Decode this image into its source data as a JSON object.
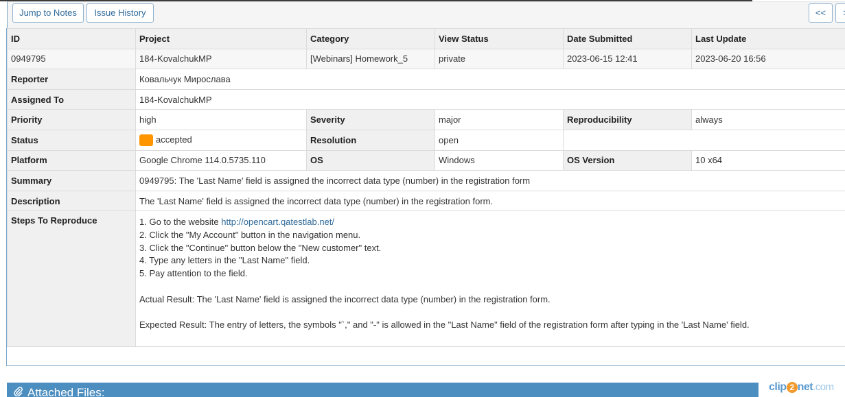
{
  "toolbar": {
    "jump_to_notes": "Jump to Notes",
    "issue_history": "Issue History",
    "prev": "<<",
    "next": ">"
  },
  "header": {
    "id": "ID",
    "project": "Project",
    "category": "Category",
    "view_status": "View Status",
    "date_submitted": "Date Submitted",
    "last_update": "Last Update"
  },
  "issue": {
    "id": "0949795",
    "project": "184-KovalchukMP",
    "category": "[Webinars] Homework_5",
    "view_status": "private",
    "date_submitted": "2023-06-15 12:41",
    "last_update": "2023-06-20 16:56"
  },
  "labels": {
    "reporter": "Reporter",
    "assigned_to": "Assigned To",
    "priority": "Priority",
    "severity": "Severity",
    "reproducibility": "Reproducibility",
    "status": "Status",
    "resolution": "Resolution",
    "platform": "Platform",
    "os": "OS",
    "os_version": "OS Version",
    "summary": "Summary",
    "description": "Description",
    "steps": "Steps To Reproduce"
  },
  "values": {
    "reporter": "Ковальчук Мирослава",
    "assigned_to": "184-KovalchukMP",
    "priority": "high",
    "severity": "major",
    "reproducibility": "always",
    "status": "accepted",
    "status_color": "#ff9500",
    "resolution": "open",
    "platform": "Google Chrome 114.0.5735.110",
    "os": "Windows",
    "os_version": "10 x64",
    "summary": "0949795: The 'Last Name' field is assigned the incorrect data type (number) in the registration form",
    "description": "The 'Last Name' field is assigned the incorrect data type (number) in the registration form."
  },
  "steps": {
    "step1_prefix": "1. Go to the website ",
    "step1_link": "http://opencart.qatestlab.net/",
    "step2": "2. Click the \"My Account\" button in the navigation menu.",
    "step3": "3. Click the \"Continue\" button below the \"New customer\" text.",
    "step4": "4. Type any letters in the \"Last Name\" field.",
    "step5": "5. Pay attention to the field.",
    "actual": "Actual Result: The 'Last Name' field is assigned the incorrect data type (number) in the registration form.",
    "expected": "Expected Result: The entry of letters, the symbols \"`,\" and \"-\" is allowed in the \"Last Name\" field of the registration form after typing in the 'Last Name' field."
  },
  "attached": {
    "title": "Attached Files:",
    "icon": "paperclip-icon"
  },
  "watermark": {
    "brand_a": "clip",
    "brand_2": "2",
    "brand_b": "net",
    "brand_com": ".com"
  }
}
